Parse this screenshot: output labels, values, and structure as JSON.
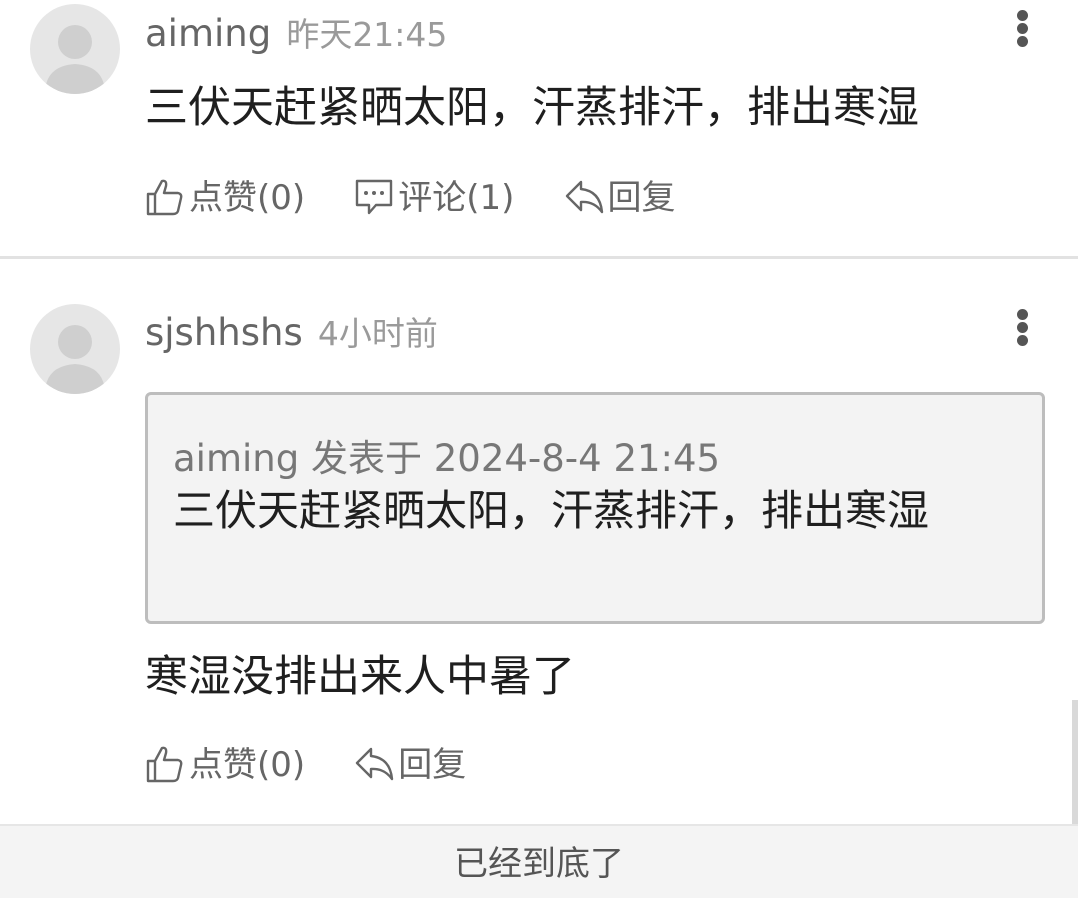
{
  "comments": [
    {
      "avatar_icon": "default-user-avatar",
      "username": "aiming",
      "time": "昨天21:45",
      "more_icon": "more-vertical-icon",
      "content": "三伏天赶紧晒太阳，汗蒸排汗，排出寒湿",
      "actions": {
        "like": "点赞(0)",
        "comment": "评论(1)",
        "reply": "回复"
      }
    },
    {
      "avatar_icon": "default-user-avatar",
      "username": "sjshhshs",
      "time": "4小时前",
      "more_icon": "more-vertical-icon",
      "quote": {
        "meta": "aiming 发表于 2024-8-4 21:45",
        "text": "三伏天赶紧晒太阳，汗蒸排汗，排出寒湿"
      },
      "content": "寒湿没排出来人中暑了",
      "actions": {
        "like": "点赞(0)",
        "reply": "回复"
      }
    }
  ],
  "footer": {
    "text": "已经到底了"
  },
  "colors": {
    "text_primary": "#1f1f1f",
    "text_secondary": "#666666",
    "text_muted": "#9a9a9a",
    "quote_bg": "#f3f3f3",
    "quote_border": "#bdbdbd",
    "divider": "#e2e2e2",
    "footer_bg": "#f4f4f4"
  }
}
